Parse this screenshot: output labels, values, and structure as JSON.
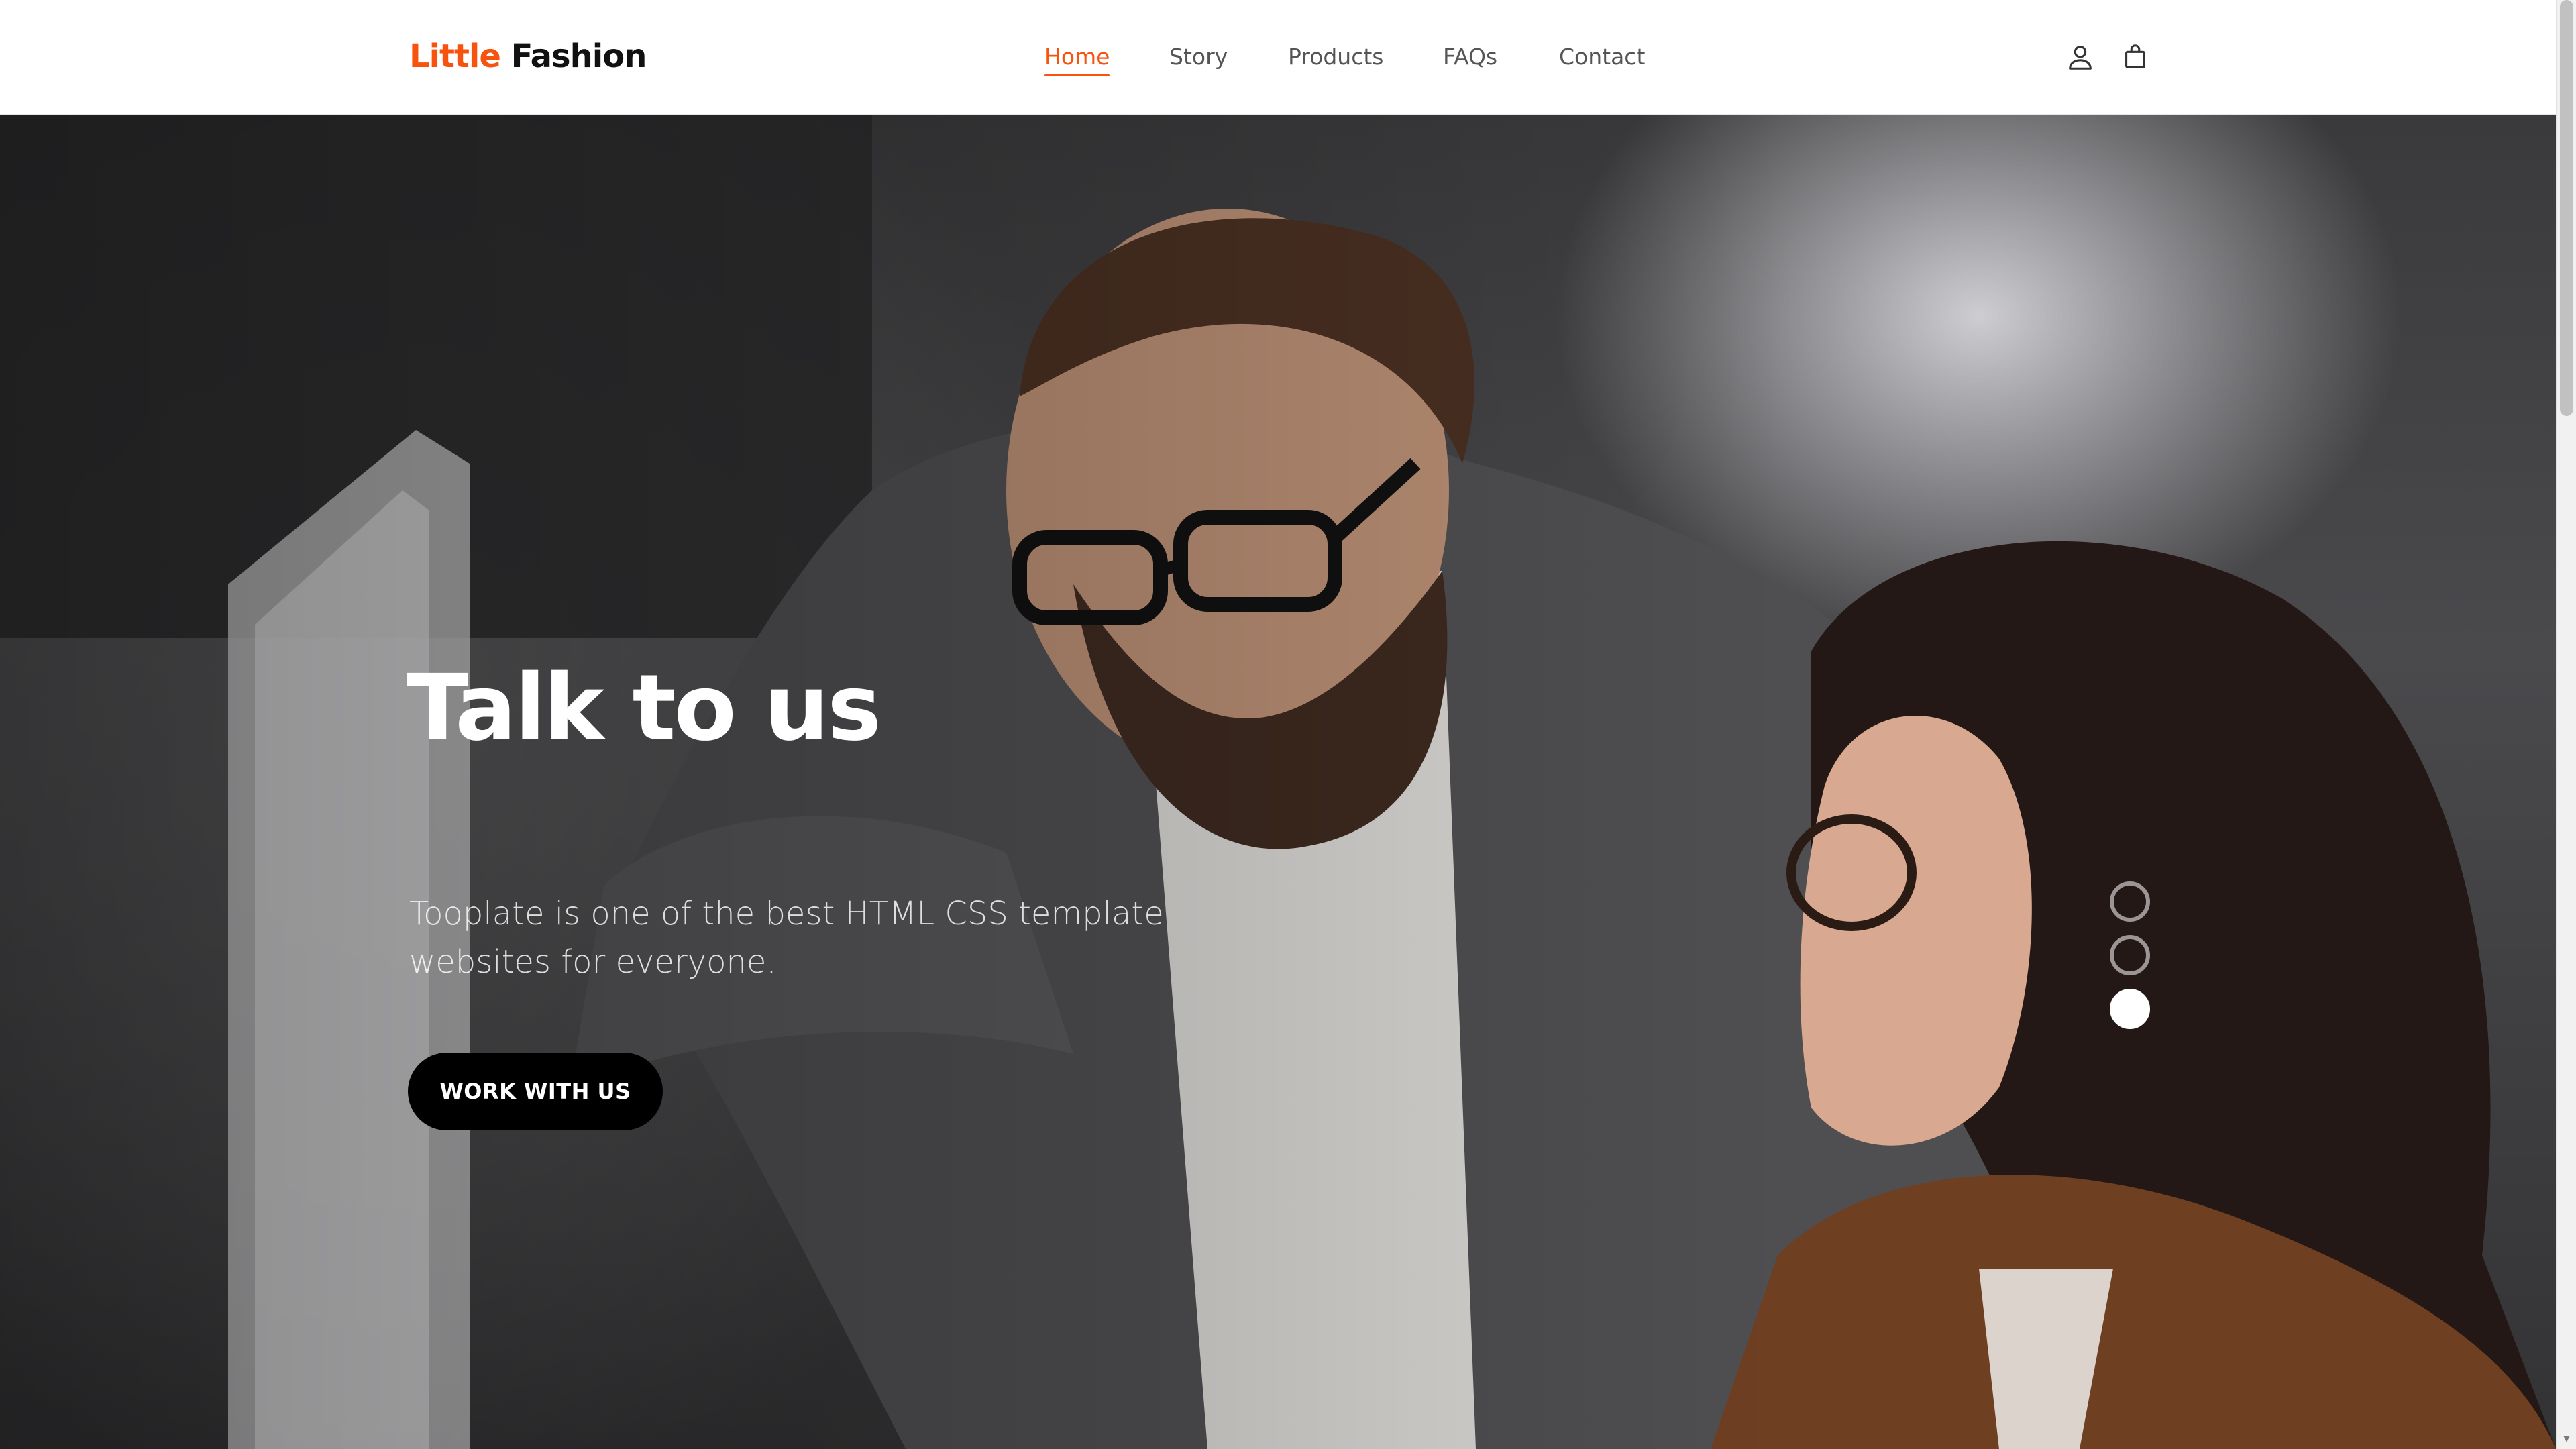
{
  "brand": {
    "part1": "Little",
    "part2": "Fashion"
  },
  "nav": {
    "items": [
      {
        "label": "Home",
        "active": true
      },
      {
        "label": "Story",
        "active": false
      },
      {
        "label": "Products",
        "active": false
      },
      {
        "label": "FAQs",
        "active": false
      },
      {
        "label": "Contact",
        "active": false
      }
    ],
    "icons": [
      "user-icon",
      "shopping-bag-icon"
    ]
  },
  "hero": {
    "title": "Talk to us",
    "text": "Tooplate is one of the best HTML CSS template websites for everyone.",
    "button_label": "WORK WITH US",
    "slides": [
      {
        "active": false
      },
      {
        "active": false
      },
      {
        "active": true
      }
    ]
  },
  "colors": {
    "accent": "#f8520f",
    "dark": "#111111",
    "nav_text": "#555555",
    "button_bg": "#000000"
  }
}
